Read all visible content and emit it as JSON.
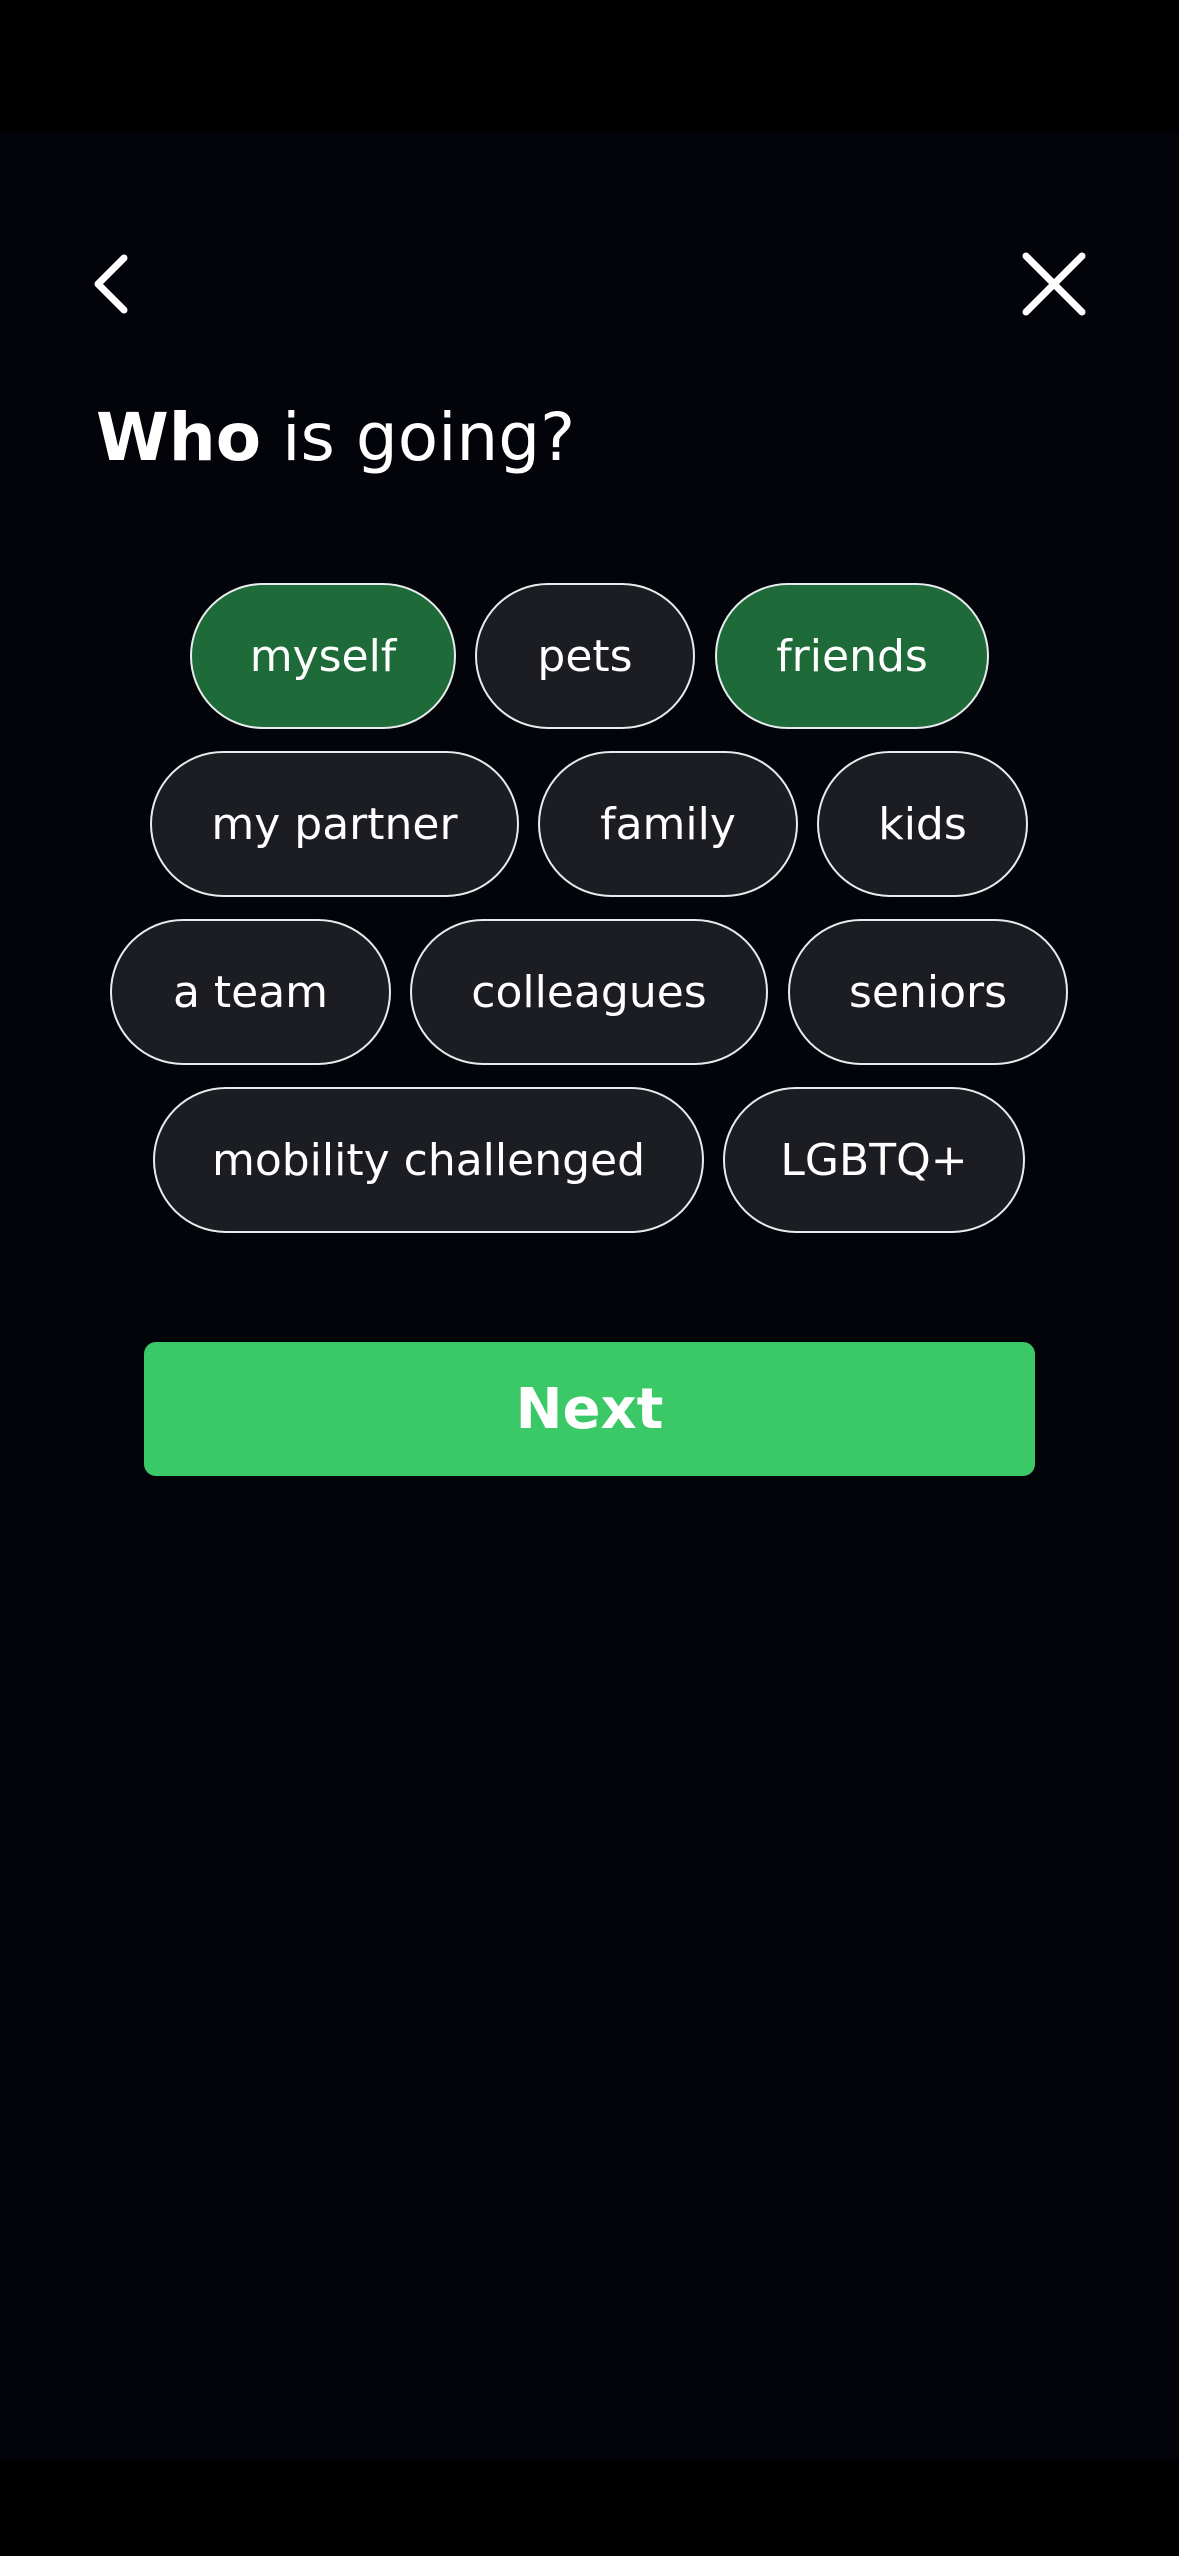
{
  "header": {
    "back_icon": "chevron-left-icon",
    "close_icon": "close-icon"
  },
  "question": {
    "strong": "Who",
    "rest": " is going?"
  },
  "options": [
    {
      "label": "myself",
      "selected": true
    },
    {
      "label": "pets",
      "selected": false
    },
    {
      "label": "friends",
      "selected": true
    },
    {
      "label": "my partner",
      "selected": false
    },
    {
      "label": "family",
      "selected": false
    },
    {
      "label": "kids",
      "selected": false
    },
    {
      "label": "a team",
      "selected": false
    },
    {
      "label": "colleagues",
      "selected": false
    },
    {
      "label": "seniors",
      "selected": false
    },
    {
      "label": "mobility challenged",
      "selected": false
    },
    {
      "label": "LGBTQ+",
      "selected": false
    }
  ],
  "next_label": "Next",
  "colors": {
    "background": "#03040a",
    "chip_default": "#1b1d22",
    "chip_selected": "#1e6a39",
    "accent": "#3ac966"
  }
}
